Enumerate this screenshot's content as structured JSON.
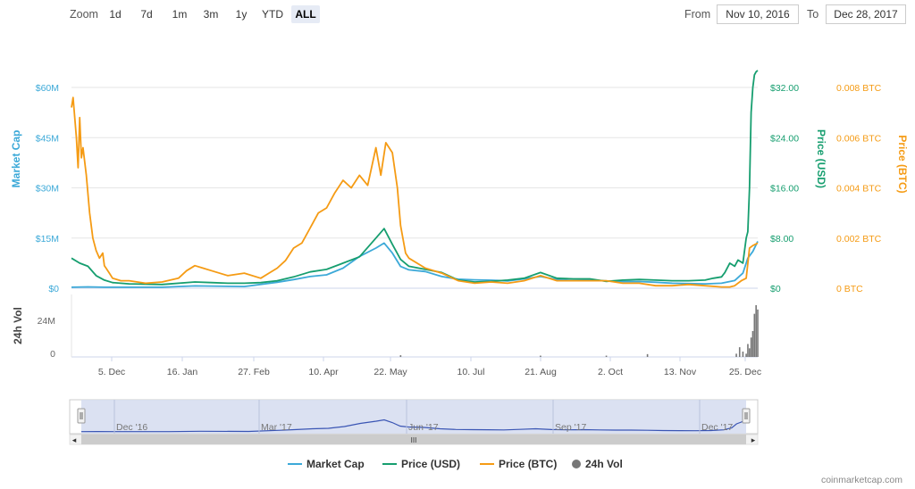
{
  "toolbar": {
    "zoom_label": "Zoom",
    "zoom_buttons": [
      "1d",
      "7d",
      "1m",
      "3m",
      "1y",
      "YTD",
      "ALL"
    ],
    "active_zoom": "ALL",
    "from_label": "From",
    "from_value": "Nov 10, 2016",
    "to_label": "To",
    "to_value": "Dec 28, 2017"
  },
  "credit": "coinmarketcap.com",
  "colors": {
    "market_cap": "#3ca9d8",
    "price_usd": "#169e6f",
    "price_btc": "#f59b14",
    "volume": "#777777",
    "navigator_fill": "#d5dcf0",
    "navigator_line": "#3a55b4"
  },
  "chart_data": {
    "type": "line",
    "x_tick_labels": [
      "5. Dec",
      "16. Jan",
      "27. Feb",
      "10. Apr",
      "22. May",
      "10. Jul",
      "21. Aug",
      "2. Oct",
      "13. Nov",
      "25. Dec"
    ],
    "left_axis": {
      "label": "Market Cap",
      "ticks": [
        "$0",
        "$15M",
        "$30M",
        "$45M",
        "$60M"
      ],
      "ylim": [
        0,
        60000000
      ]
    },
    "right_axis_usd": {
      "label": "Price (USD)",
      "ticks": [
        "$0",
        "$8.00",
        "$16.00",
        "$24.00",
        "$32.00"
      ],
      "ylim": [
        0,
        32
      ]
    },
    "right_axis_btc": {
      "label": "Price (BTC)",
      "ticks": [
        "0 BTC",
        "0.002 BTC",
        "0.004 BTC",
        "0.006 BTC",
        "0.008 BTC"
      ],
      "ylim": [
        0,
        0.008
      ]
    },
    "volume_axis": {
      "label": "24h Vol",
      "ticks": [
        "0",
        "24M"
      ],
      "ylim": [
        0,
        24000000
      ]
    },
    "x_range_days": [
      -25,
      392
    ],
    "series": [
      {
        "name": "Market Cap",
        "unit": "USD",
        "x": [
          -25,
          -15,
          -5,
          10,
          30,
          50,
          80,
          100,
          110,
          120,
          130,
          140,
          150,
          160,
          165,
          170,
          175,
          180,
          190,
          200,
          210,
          220,
          230,
          240,
          250,
          260,
          270,
          280,
          290,
          300,
          310,
          320,
          330,
          340,
          350,
          360,
          370,
          378,
          383,
          386,
          389,
          392
        ],
        "values": [
          300000,
          400000,
          300000,
          300000,
          300000,
          700000,
          500000,
          1800000,
          2600000,
          3500000,
          4000000,
          6000000,
          9500000,
          12000000,
          13500000,
          10500000,
          6500000,
          5500000,
          5000000,
          3500000,
          2700000,
          2500000,
          2400000,
          2200000,
          2800000,
          3500000,
          2600000,
          2300000,
          2500000,
          2200000,
          2000000,
          2000000,
          1800000,
          1500000,
          1400000,
          1300000,
          1500000,
          2300000,
          4500000,
          9000000,
          11000000,
          14000000
        ]
      },
      {
        "name": "Price (USD)",
        "unit": "USD",
        "x": [
          -25,
          -20,
          -15,
          -10,
          -5,
          0,
          10,
          30,
          50,
          60,
          70,
          80,
          90,
          100,
          110,
          120,
          130,
          140,
          150,
          160,
          165,
          170,
          175,
          180,
          190,
          200,
          210,
          220,
          230,
          240,
          250,
          260,
          270,
          280,
          290,
          300,
          310,
          320,
          330,
          340,
          350,
          360,
          365,
          370,
          372,
          375,
          378,
          380,
          383,
          385,
          386,
          387,
          388,
          389,
          390,
          391,
          392
        ],
        "values": [
          4.8,
          4.0,
          3.5,
          2.0,
          1.3,
          0.9,
          0.7,
          0.6,
          1.0,
          0.9,
          0.8,
          0.8,
          0.9,
          1.2,
          1.8,
          2.6,
          3.0,
          4.0,
          5.0,
          8.0,
          9.5,
          7.0,
          4.6,
          3.5,
          3.0,
          2.5,
          1.3,
          1.0,
          1.1,
          1.3,
          1.6,
          2.5,
          1.6,
          1.5,
          1.5,
          1.1,
          1.3,
          1.4,
          1.3,
          1.2,
          1.2,
          1.3,
          1.6,
          1.8,
          2.5,
          4.0,
          3.5,
          4.5,
          4.0,
          8.0,
          9.0,
          16.0,
          28.0,
          32.0,
          34.0,
          34.5,
          34.7
        ]
      },
      {
        "name": "Price (BTC)",
        "unit": "BTC",
        "x": [
          -25,
          -24,
          -22,
          -21,
          -20,
          -19,
          -18,
          -16,
          -14,
          -12,
          -10,
          -8,
          -6,
          -5,
          -4,
          -2,
          0,
          5,
          10,
          20,
          30,
          40,
          45,
          50,
          55,
          60,
          70,
          80,
          90,
          95,
          100,
          105,
          110,
          115,
          120,
          125,
          130,
          135,
          140,
          145,
          150,
          155,
          158,
          160,
          163,
          166,
          170,
          173,
          175,
          178,
          180,
          190,
          200,
          210,
          220,
          230,
          240,
          250,
          260,
          270,
          280,
          290,
          300,
          310,
          320,
          330,
          340,
          350,
          360,
          370,
          375,
          378,
          380,
          382,
          385,
          387,
          389,
          392
        ],
        "values": [
          0.0072,
          0.0076,
          0.006,
          0.0048,
          0.0068,
          0.0052,
          0.0056,
          0.0045,
          0.003,
          0.002,
          0.0015,
          0.0012,
          0.0014,
          0.0009,
          0.0008,
          0.0006,
          0.0004,
          0.0003,
          0.0003,
          0.0002,
          0.00025,
          0.0004,
          0.0007,
          0.0009,
          0.0008,
          0.0007,
          0.0005,
          0.0006,
          0.0004,
          0.0006,
          0.0008,
          0.0011,
          0.0016,
          0.0018,
          0.0024,
          0.003,
          0.0032,
          0.0038,
          0.0043,
          0.004,
          0.0045,
          0.0041,
          0.005,
          0.0056,
          0.0045,
          0.0058,
          0.0054,
          0.004,
          0.0025,
          0.0014,
          0.0012,
          0.0008,
          0.0006,
          0.0003,
          0.0002,
          0.00025,
          0.0002,
          0.0003,
          0.0005,
          0.0003,
          0.0003,
          0.0003,
          0.0003,
          0.0002,
          0.0002,
          0.0001,
          0.0001,
          0.00015,
          0.0001,
          5e-05,
          5e-05,
          0.0001,
          0.0002,
          0.0003,
          0.0004,
          0.0016,
          0.0017,
          0.0018
        ]
      },
      {
        "name": "24h Vol",
        "unit": "USD",
        "x": [
          175,
          260,
          300,
          325,
          379,
          381,
          383,
          385,
          386,
          387,
          388,
          389,
          390,
          391,
          392
        ],
        "values": [
          800000,
          600000,
          600000,
          1300000,
          1500000,
          4500000,
          2500000,
          1500000,
          6000000,
          4000000,
          9000000,
          12000000,
          20000000,
          24000000,
          22000000
        ]
      }
    ],
    "navigator": {
      "tick_labels": [
        "Dec '16",
        "Mar '17",
        "Jun '17",
        "Sep '17",
        "Dec '17"
      ],
      "grip_label": "III"
    },
    "legend": {
      "placement": "bottom-center",
      "items": [
        "Market Cap",
        "Price (USD)",
        "Price (BTC)",
        "24h Vol"
      ]
    }
  }
}
